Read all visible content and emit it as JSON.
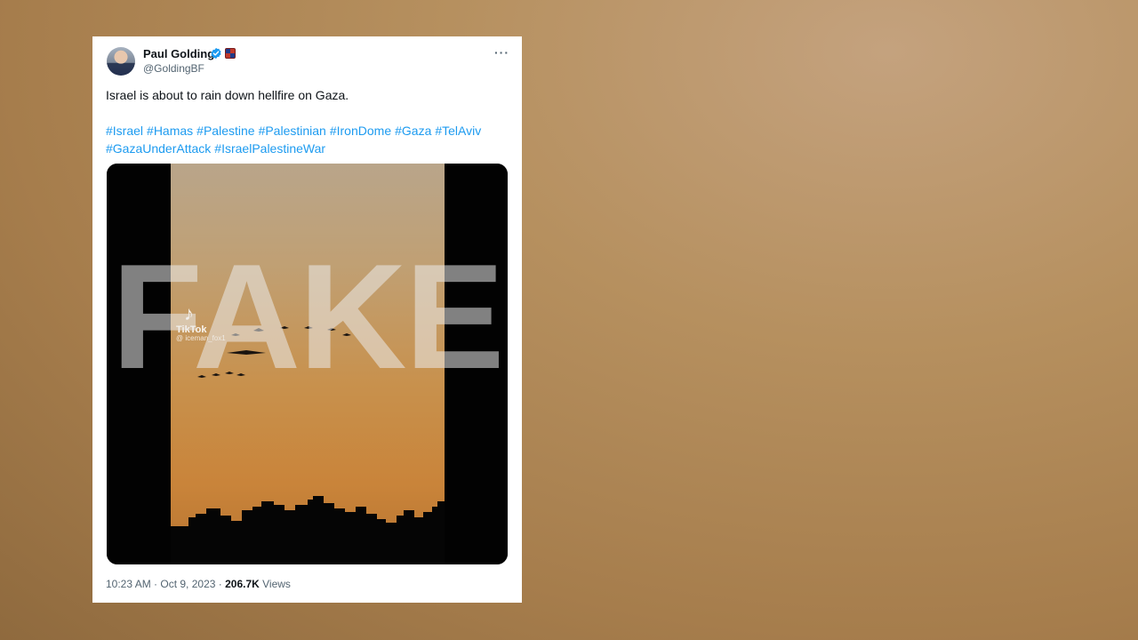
{
  "tweet": {
    "author_name": "Paul Golding",
    "author_handle": "@GoldingBF",
    "more_label": "···",
    "text": "Israel is about to rain down hellfire on Gaza.",
    "hashtags": [
      "#Israel",
      "#Hamas",
      "#Palestine",
      "#Palestinian",
      "#IronDome",
      "#Gaza",
      "#TelAviv",
      "#GazaUnderAttack",
      "#IsraelPalestineWar"
    ],
    "media": {
      "watermark": "FAKE",
      "tiktok_logo": "♪",
      "tiktok_brand": "TikTok",
      "tiktok_user": "@ iceman_fox1"
    },
    "time": "10:23 AM",
    "separator": " · ",
    "date": "Oct 9, 2023",
    "views_count": "206.7K",
    "views_label": " Views"
  },
  "colors": {
    "link": "#1d9bf0",
    "verified": "#1d9bf0",
    "muted": "#536471",
    "text": "#0f1419"
  },
  "icons": [
    "verified-badge-icon",
    "affiliate-badge-icon",
    "more-options-icon",
    "tiktok-logo-icon"
  ]
}
